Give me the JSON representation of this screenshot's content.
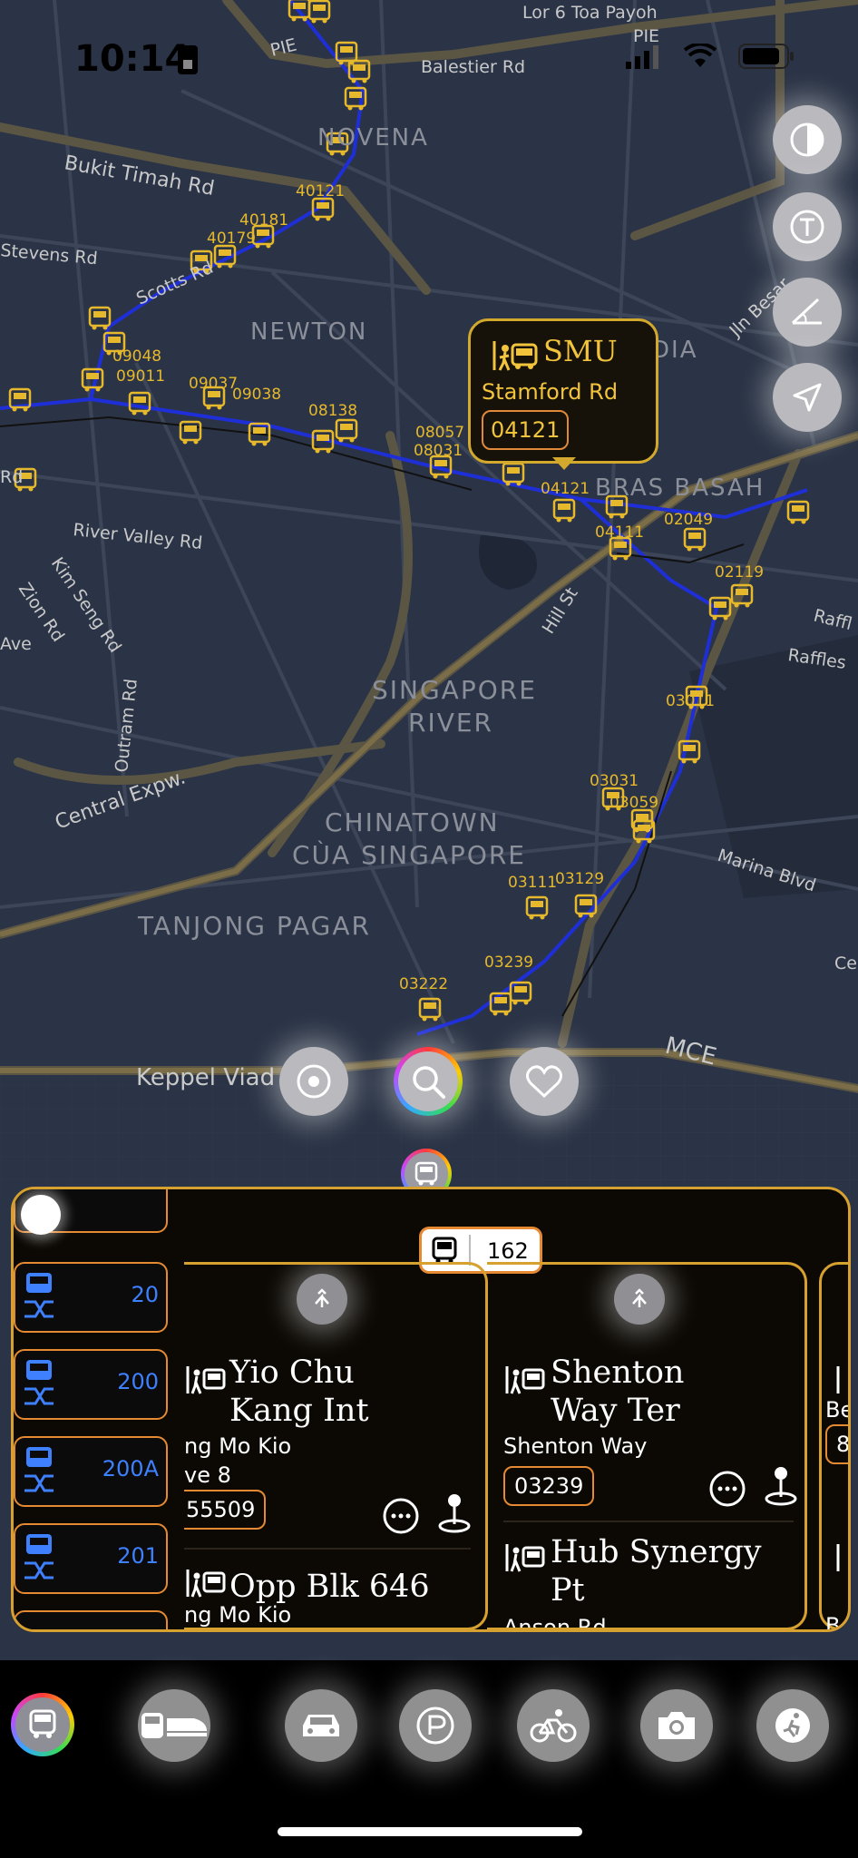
{
  "status_bar": {
    "time": "10:14"
  },
  "map": {
    "places": [
      {
        "key": "novena",
        "text": "NOVENA"
      },
      {
        "key": "newton",
        "text": "NEWTON"
      },
      {
        "key": "river",
        "text": "SINGAPORE RIVER"
      },
      {
        "key": "chinatown",
        "text": "CHINATOWN CÙA SINGAPORE"
      },
      {
        "key": "tanjong",
        "text": "TANJONG PAGAR"
      },
      {
        "key": "brasbasah",
        "text": "BRAS BASAH"
      },
      {
        "key": "dia",
        "text": "DIA"
      }
    ],
    "roads": {
      "pie1": "PIE",
      "pie2": "PIE",
      "lor6": "Lor 6 Toa Payoh",
      "balestier": "Balestier Rd",
      "bukit": "Bukit Timah Rd",
      "stevens": "Stevens Rd",
      "scotts": "Scotts Rd",
      "rivervalley": "River Valley Rd",
      "kimseng": "Kim Seng Rd",
      "zion": "Zion Rd",
      "ave": "Ave",
      "outram": "Outram Rd",
      "central": "Central Expw.",
      "hill": "Hill St",
      "raffles1": "Raffl",
      "raffles2": "Raffles",
      "marina": "Marina Blvd",
      "ce": "Ce",
      "keppel": "Keppel Viad",
      "mce": "MCE",
      "jlnbesar": "Jln Besar",
      "rd": "Rd"
    },
    "stop_codes": [
      "40181",
      "40179",
      "09048",
      "09011",
      "09037",
      "08057",
      "08031",
      "04121",
      "02049",
      "04111",
      "02119",
      "03011",
      "03031",
      "03059",
      "03111",
      "03129",
      "03222",
      "03239",
      "40121",
      "09038",
      "08138"
    ]
  },
  "callout": {
    "name": "SMU",
    "road": "Stamford Rd",
    "code": "04121"
  },
  "panel": {
    "selected_service": "162",
    "routes": [
      "20",
      "200",
      "200A",
      "201"
    ],
    "stops_left": [
      {
        "name": "Yio Chu Kang Int",
        "road": "ng Mo Kio",
        "road2": "ve 8",
        "code": "55509"
      },
      {
        "name": "Opp Blk 646",
        "road": "ng Mo Kio"
      }
    ],
    "stops_right": [
      {
        "name": "Shenton Way Ter",
        "road": "Shenton Way",
        "code": "03239"
      },
      {
        "name": "Hub Synergy Pt",
        "road": "Anson Rd"
      }
    ],
    "third_col": {
      "road": "Be",
      "code": "8",
      "road2": "B"
    }
  },
  "dock": {
    "items": [
      {
        "name": "transit-icon"
      },
      {
        "name": "car-icon"
      },
      {
        "name": "parking-icon"
      },
      {
        "name": "bicycle-icon"
      },
      {
        "name": "camera-icon"
      },
      {
        "name": "activity-icon"
      }
    ]
  },
  "colors": {
    "accent": "#d7a12f",
    "stop_icon": "#f2c43c",
    "route_line": "#1f2fd8",
    "route_num": "#3f80ff"
  }
}
